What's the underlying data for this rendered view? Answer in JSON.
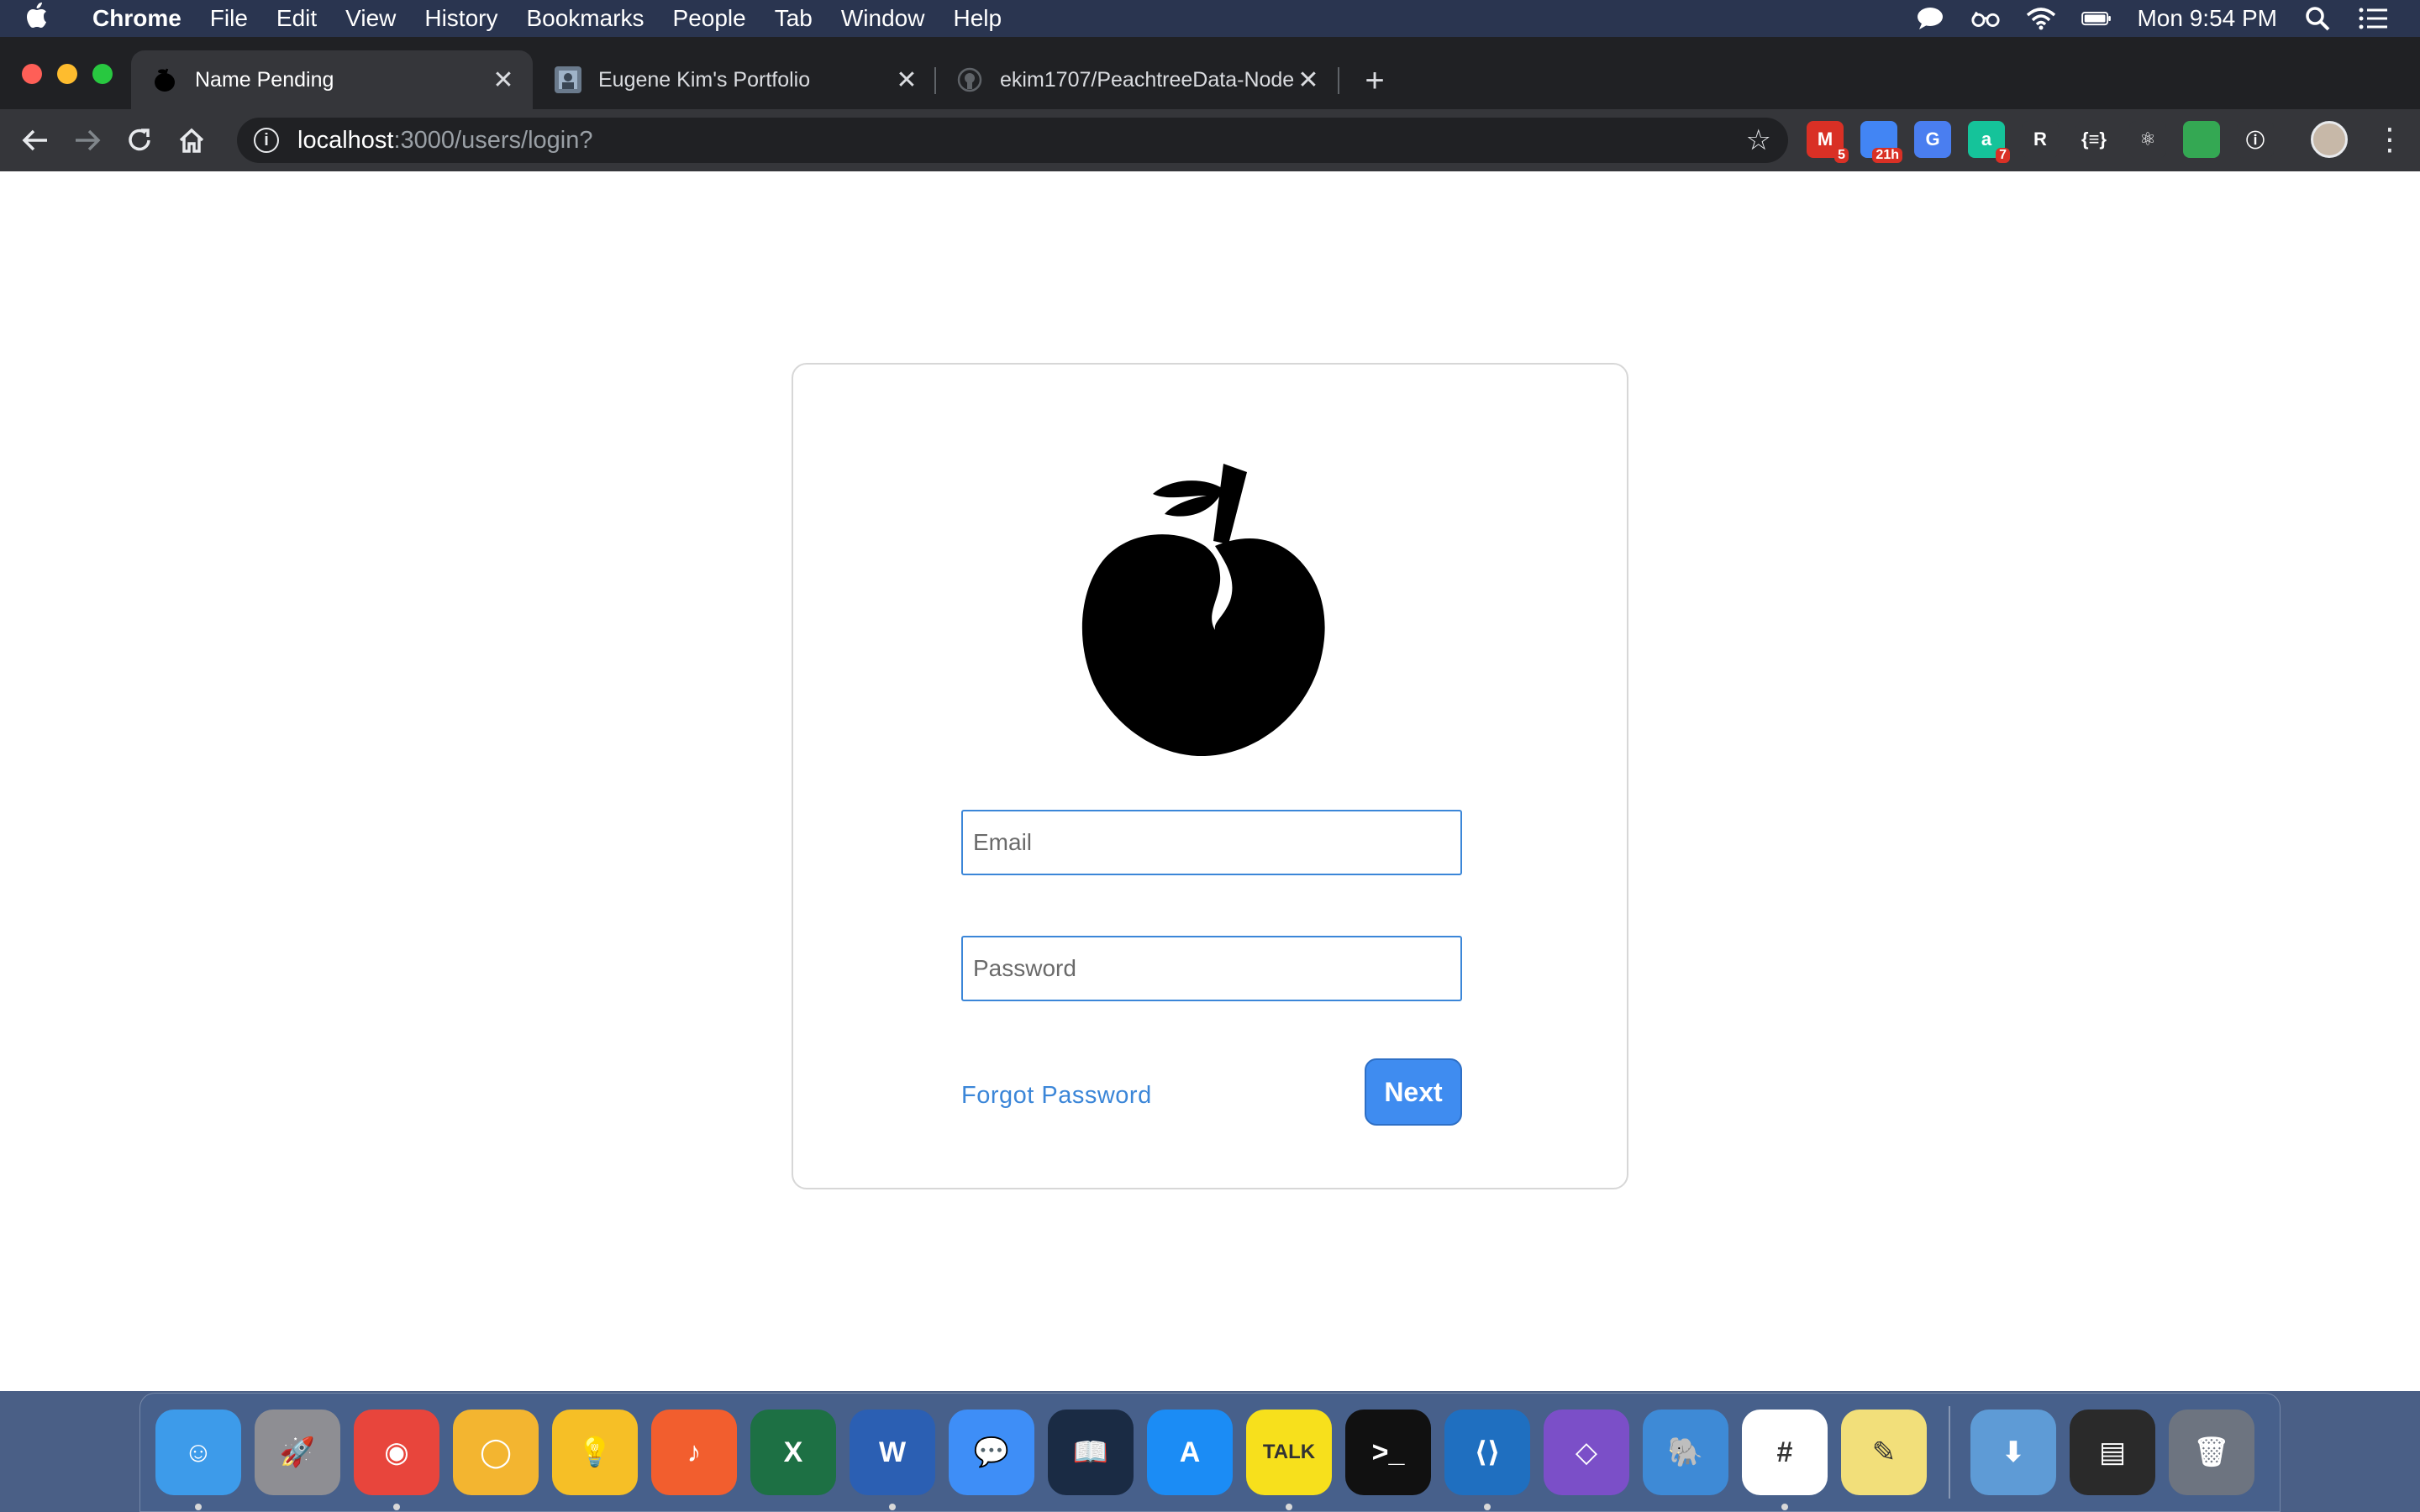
{
  "menubar": {
    "app": "Chrome",
    "items": [
      "File",
      "Edit",
      "View",
      "History",
      "Bookmarks",
      "People",
      "Tab",
      "Window",
      "Help"
    ],
    "clock": "Mon 9:54 PM",
    "status_icons": [
      "messages-icon",
      "glasses-icon",
      "wifi-icon",
      "battery-icon",
      "spotlight-icon",
      "notification-center-icon"
    ]
  },
  "tabs": [
    {
      "title": "Name Pending",
      "active": true,
      "favicon": "apple-icon"
    },
    {
      "title": "Eugene Kim's Portfolio",
      "active": false,
      "favicon": "portfolio-icon"
    },
    {
      "title": "ekim1707/PeachtreeData-Node",
      "active": false,
      "favicon": "github-icon"
    }
  ],
  "toolbar": {
    "url_host": "localhost",
    "url_path": ":3000/users/login?",
    "extensions": [
      {
        "name": "gmail-extension",
        "color": "#d93025",
        "glyph": "M",
        "badge": "5"
      },
      {
        "name": "calendar-extension",
        "color": "#4285f4",
        "glyph": "",
        "badge": "21h"
      },
      {
        "name": "translate-extension",
        "color": "#4a7ef0",
        "glyph": "G",
        "badge": ""
      },
      {
        "name": "grammarly-extension",
        "color": "#15c39a",
        "glyph": "a",
        "badge": "7"
      },
      {
        "name": "r-extension",
        "color": "#35363a",
        "glyph": "R",
        "badge": ""
      },
      {
        "name": "json-extension",
        "color": "#35363a",
        "glyph": "{≡}",
        "badge": ""
      },
      {
        "name": "react-devtools-extension",
        "color": "#35363a",
        "glyph": "⚛",
        "badge": ""
      },
      {
        "name": "green-dot-extension",
        "color": "#34a853",
        "glyph": "",
        "badge": ""
      },
      {
        "name": "lastpass-extension",
        "color": "#35363a",
        "glyph": "ⓘ",
        "badge": ""
      }
    ]
  },
  "login": {
    "email_placeholder": "Email",
    "password_placeholder": "Password",
    "forgot_label": "Forgot Password",
    "next_label": "Next"
  },
  "dock": {
    "apps": [
      {
        "name": "finder",
        "color": "#3d9bea",
        "glyph": "☺",
        "running": true
      },
      {
        "name": "launchpad",
        "color": "#8e8e93",
        "glyph": "🚀",
        "running": false
      },
      {
        "name": "chrome",
        "color": "#e8453c",
        "glyph": "◉",
        "running": true
      },
      {
        "name": "chrome-canary",
        "color": "#f3b530",
        "glyph": "◯",
        "running": false
      },
      {
        "name": "keep",
        "color": "#f6bf26",
        "glyph": "💡",
        "running": false
      },
      {
        "name": "music",
        "color": "#f25e2e",
        "glyph": "♪",
        "running": false
      },
      {
        "name": "excel",
        "color": "#1d7044",
        "glyph": "X",
        "running": false
      },
      {
        "name": "word",
        "color": "#2b5fb3",
        "glyph": "W",
        "running": true
      },
      {
        "name": "messages",
        "color": "#3e8ef7",
        "glyph": "💬",
        "running": false
      },
      {
        "name": "kindle",
        "color": "#1a2b44",
        "glyph": "📖",
        "running": false
      },
      {
        "name": "app-store",
        "color": "#1b8cf5",
        "glyph": "A",
        "running": false
      },
      {
        "name": "kakaotalk",
        "color": "#f7e01c",
        "glyph": "TALK",
        "running": true
      },
      {
        "name": "terminal",
        "color": "#111111",
        "glyph": ">_",
        "running": false
      },
      {
        "name": "vscode",
        "color": "#1f6fc0",
        "glyph": "⟨⟩",
        "running": true
      },
      {
        "name": "visual-studio",
        "color": "#7b4fc8",
        "glyph": "◇",
        "running": false
      },
      {
        "name": "tableplus",
        "color": "#3e8ad6",
        "glyph": "🐘",
        "running": false
      },
      {
        "name": "slack",
        "color": "#ffffff",
        "glyph": "#",
        "running": true
      },
      {
        "name": "stickies",
        "color": "#f2df7a",
        "glyph": "✎",
        "running": false
      }
    ],
    "after_separator": [
      {
        "name": "downloads-folder",
        "color": "#5e9bd6",
        "glyph": "⬇"
      },
      {
        "name": "window-preview",
        "color": "#2a2a2a",
        "glyph": "▤"
      },
      {
        "name": "trash",
        "color": "#6d7480",
        "glyph": "🗑"
      }
    ]
  }
}
